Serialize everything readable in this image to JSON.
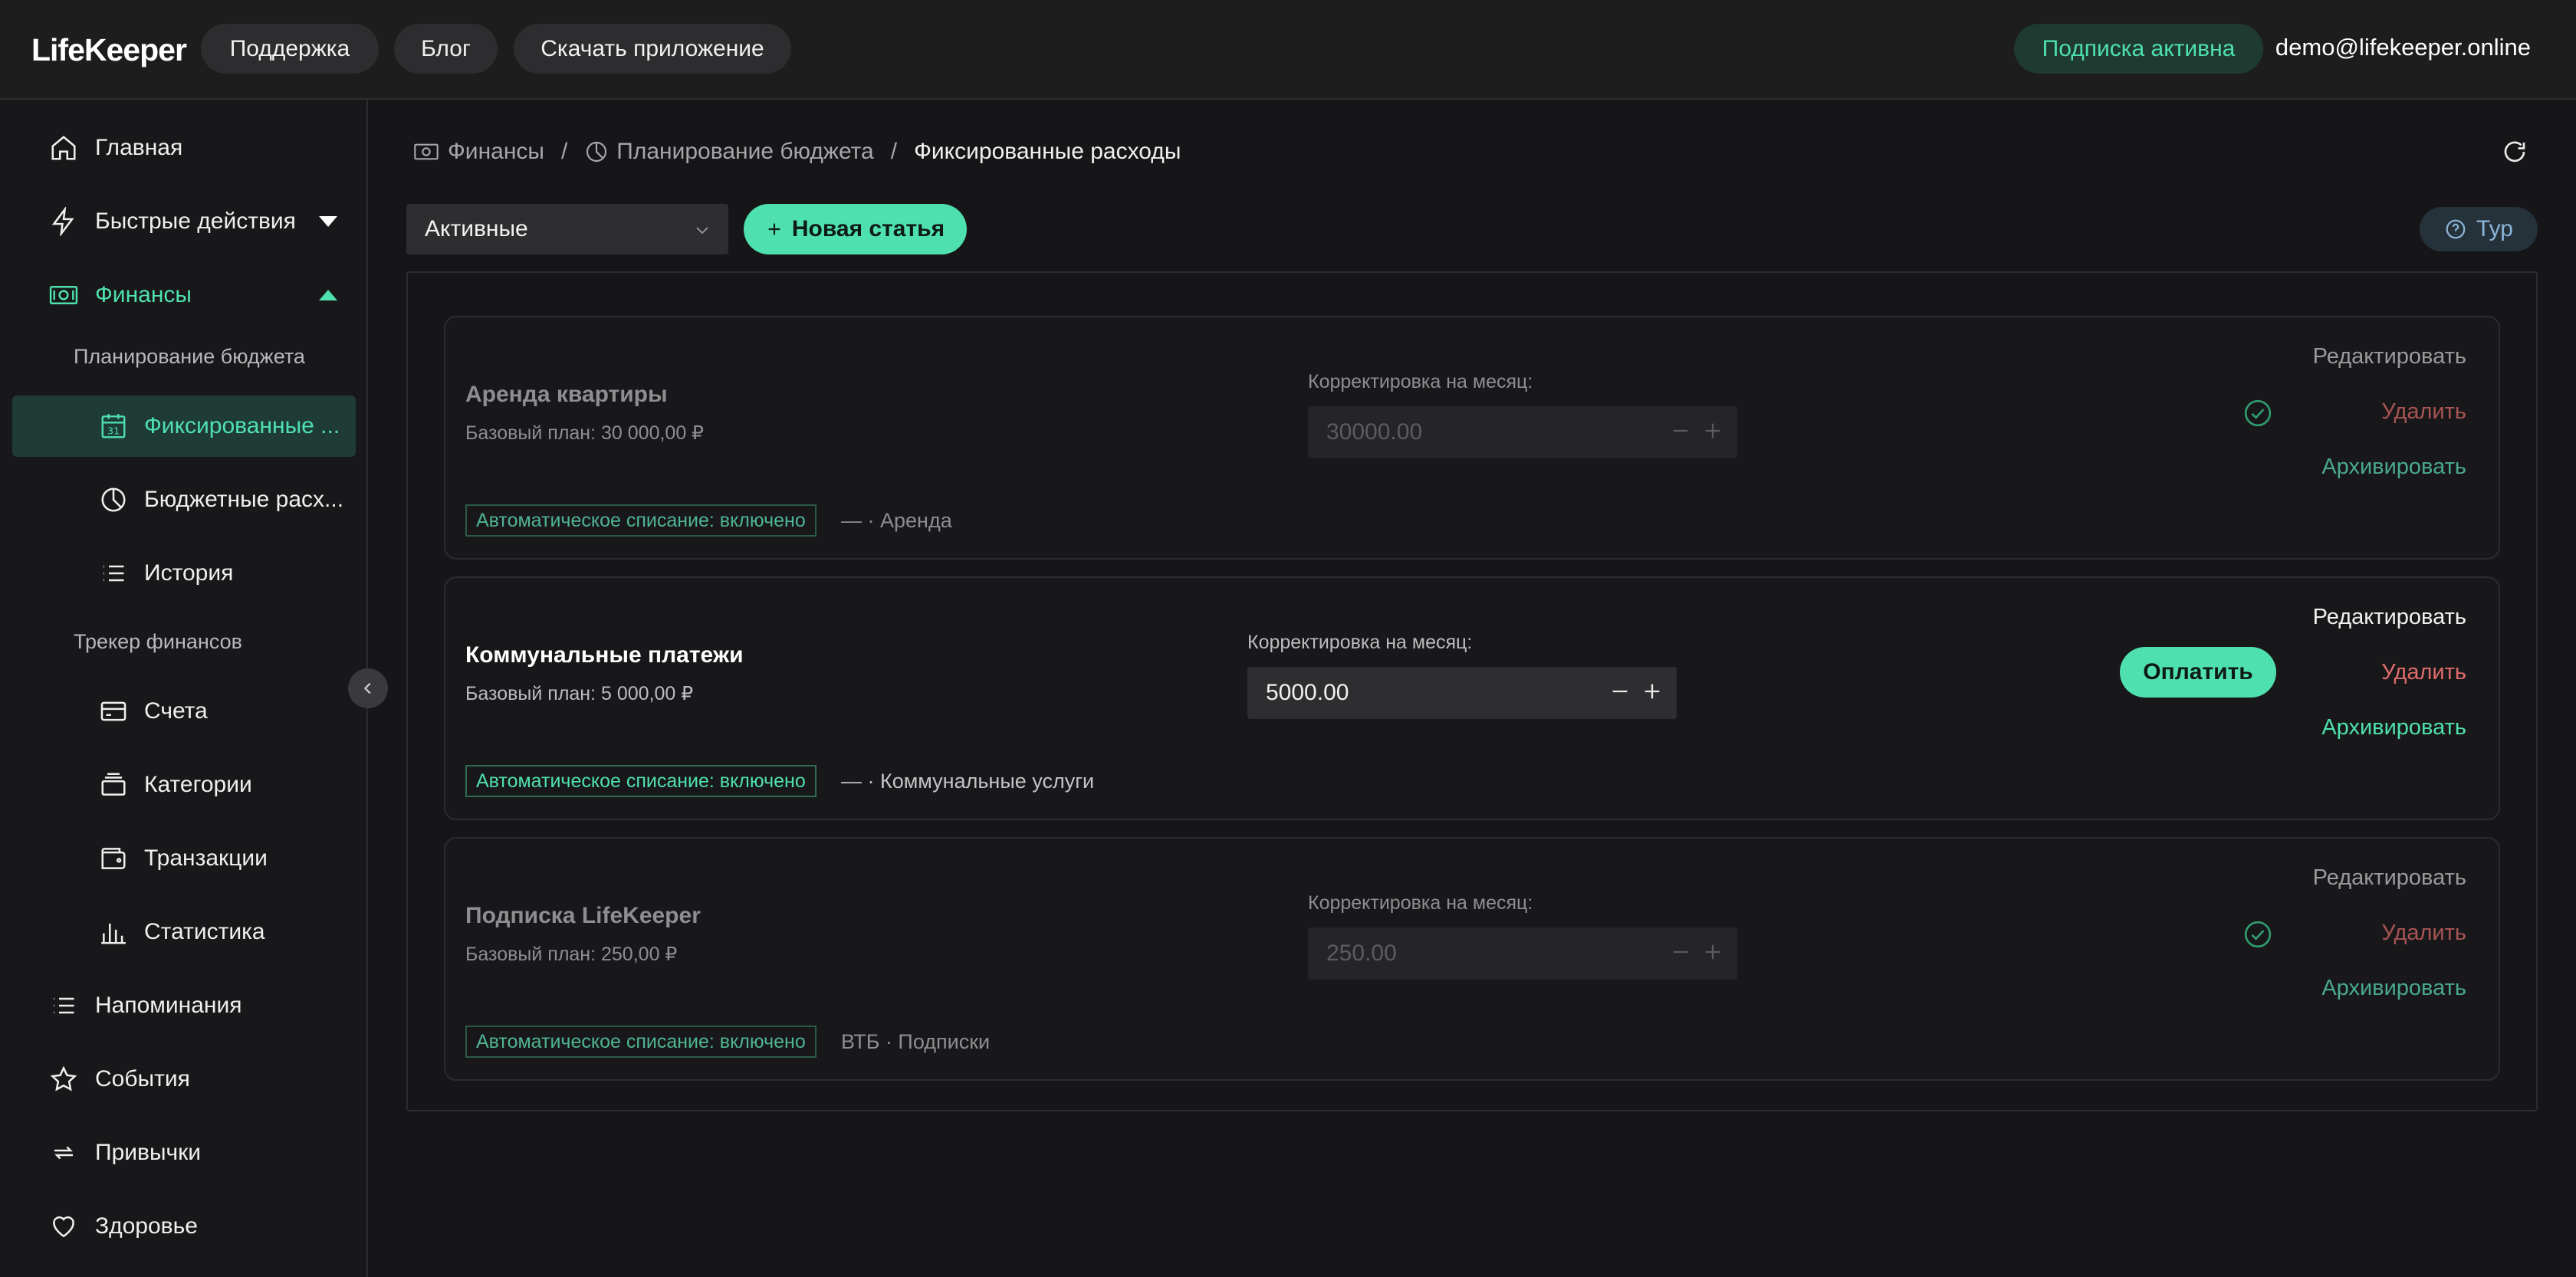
{
  "header": {
    "logo": "LifeKeeper",
    "nav": {
      "support": "Поддержка",
      "blog": "Блог",
      "download": "Скачать приложение"
    },
    "subscription_status": "Подписка активна",
    "user_email": "demo@lifekeeper.online"
  },
  "sidebar": {
    "home": "Главная",
    "quick_actions": "Быстрые действия",
    "finances": "Финансы",
    "budget_group": "Планирование бюджета",
    "fixed_expenses": "Фиксированные ...",
    "budget_expenses": "Бюджетные расх...",
    "history": "История",
    "tracker_group": "Трекер финансов",
    "accounts": "Счета",
    "categories": "Категории",
    "transactions": "Транзакции",
    "statistics": "Статистика",
    "reminders": "Напоминания",
    "events": "События",
    "habits": "Привычки",
    "health": "Здоровье"
  },
  "breadcrumb": {
    "finances": "Финансы",
    "budget": "Планирование бюджета",
    "current": "Фиксированные расходы",
    "separator": "/"
  },
  "toolbar": {
    "filter_value": "Активные",
    "new_item": "Новая статья",
    "tour": "Тур"
  },
  "cards": [
    {
      "title": "Аренда квартиры",
      "plan": "Базовый план: 30 000,00 ₽",
      "adj_label": "Корректировка на месяц:",
      "adj_value": "30000.00",
      "badge": "Автоматическое списание: включено",
      "meta": "— · Аренда",
      "edit": "Редактировать",
      "delete": "Удалить",
      "archive": "Архивировать"
    },
    {
      "title": "Коммунальные платежи",
      "plan": "Базовый план: 5 000,00 ₽",
      "adj_label": "Корректировка на месяц:",
      "adj_value": "5000.00",
      "badge": "Автоматическое списание: включено",
      "meta": "— · Коммунальные услуги",
      "pay": "Оплатить",
      "edit": "Редактировать",
      "delete": "Удалить",
      "archive": "Архивировать"
    },
    {
      "title": "Подписка LifeKeeper",
      "plan": "Базовый план: 250,00 ₽",
      "adj_label": "Корректировка на месяц:",
      "adj_value": "250.00",
      "badge": "Автоматическое списание: включено",
      "meta": "ВТБ · Подписки",
      "edit": "Редактировать",
      "delete": "Удалить",
      "archive": "Архивировать"
    }
  ],
  "colors": {
    "accent": "#4fe0b0",
    "danger": "#e06b6b",
    "background": "#161618",
    "surface": "#1d1d1d"
  }
}
